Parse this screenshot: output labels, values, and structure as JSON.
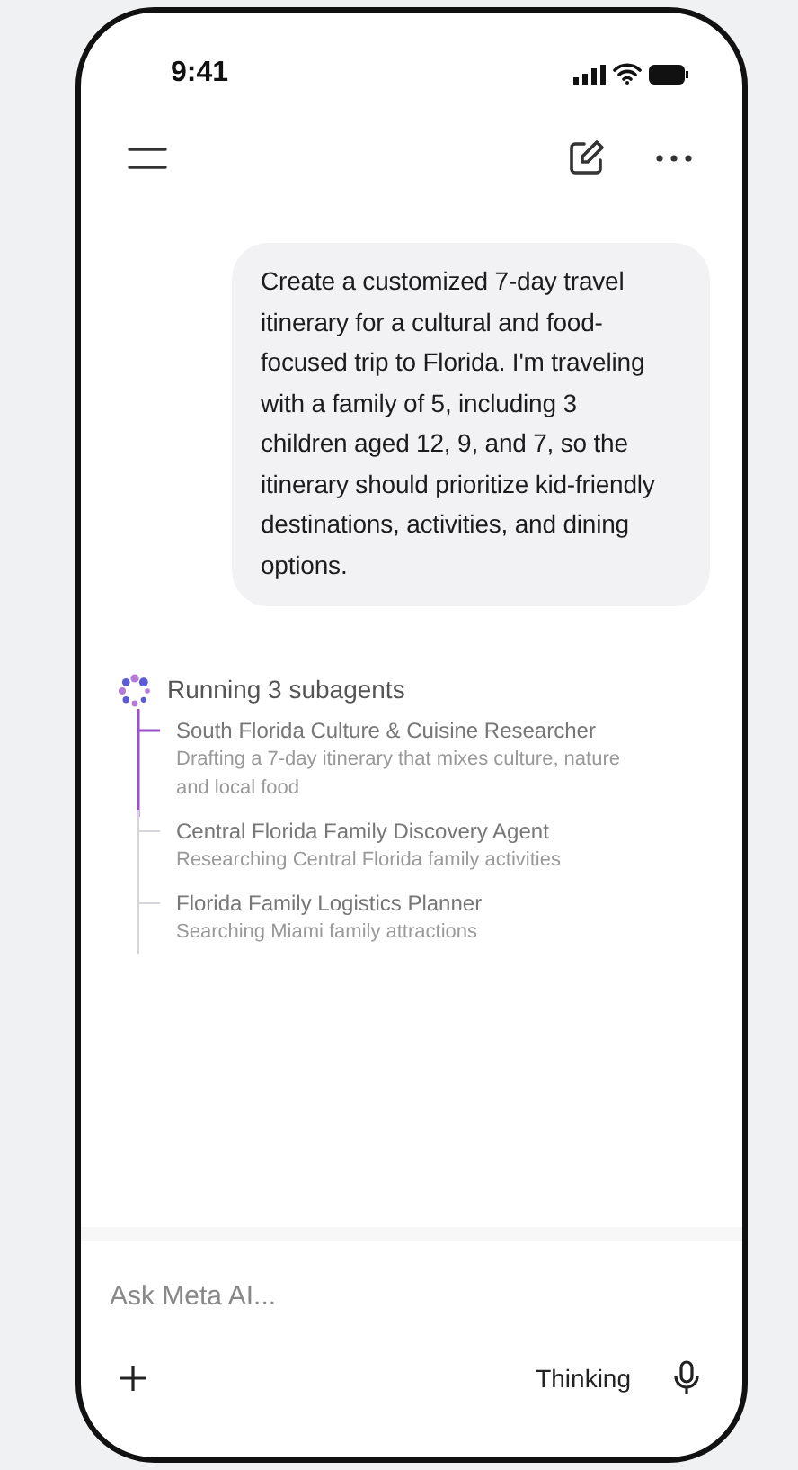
{
  "status_bar": {
    "time": "9:41"
  },
  "message": {
    "text": "Create a customized 7-day travel itinerary for a cultural and food-focused trip to Florida. I'm traveling with a family of 5, including 3 children aged 12, 9, and 7, so the itinerary should prioritize kid-friendly destinations, activities, and dining options."
  },
  "subagents": {
    "title": "Running 3 subagents",
    "items": [
      {
        "name": "South Florida Culture & Cuisine Researcher",
        "status": "Drafting a 7-day itinerary that mixes culture, nature and local food",
        "active": true
      },
      {
        "name": "Central Florida Family Discovery Agent",
        "status": "Researching Central Florida family activities",
        "active": false
      },
      {
        "name": "Florida Family Logistics Planner",
        "status": "Searching Miami family attractions",
        "active": false
      }
    ]
  },
  "composer": {
    "placeholder": "Ask Meta AI...",
    "mode_button": "Thinking"
  }
}
